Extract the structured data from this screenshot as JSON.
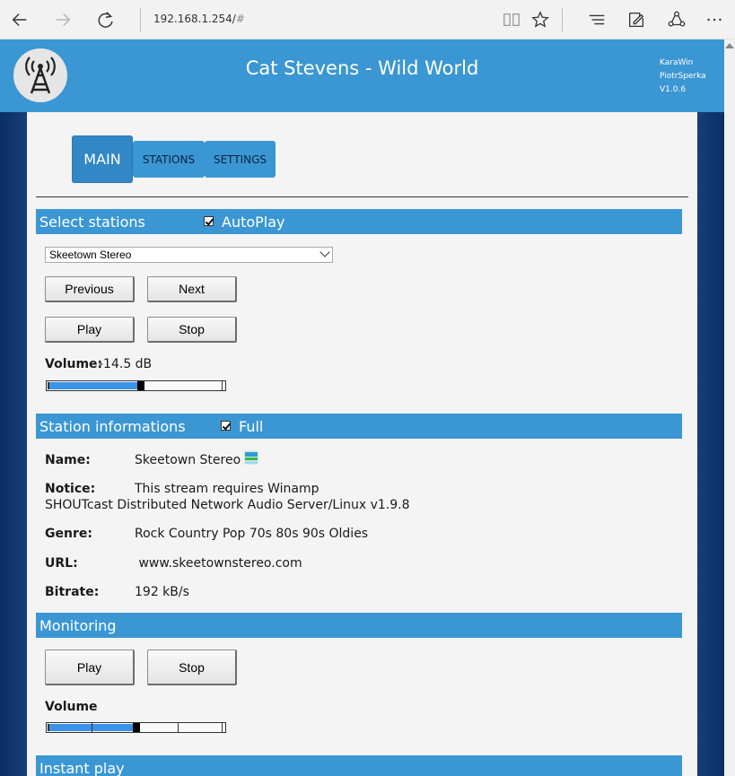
{
  "browser": {
    "url": "192.168.1.254/",
    "url_hash": "#"
  },
  "header": {
    "title": "Cat Stevens - Wild World",
    "credits": [
      "KaraWin",
      "PiotrSperka",
      "V1.0.6"
    ]
  },
  "tabs": [
    {
      "label": "MAIN",
      "active": true
    },
    {
      "label": "STATIONS",
      "active": false
    },
    {
      "label": "SETTINGS",
      "active": false
    }
  ],
  "select_stations": {
    "section_title": "Select stations",
    "autoplay_label": "AutoPlay",
    "autoplay_checked": true,
    "selected_station": "Skeetown Stereo",
    "previous_label": "Previous",
    "next_label": "Next",
    "play_label": "Play",
    "stop_label": "Stop",
    "volume_label": "Volume:",
    "volume_value": "-14.5 dB",
    "volume_level": 0.52
  },
  "station_info": {
    "section_title": "Station informations",
    "full_label": "Full",
    "full_checked": true,
    "name_label": "Name:",
    "name_value": "Skeetown Stereo",
    "notice_label": "Notice:",
    "notice_line1": "This stream requires Winamp",
    "notice_line2": "SHOUTcast Distributed Network Audio Server/Linux v1.9.8",
    "genre_label": "Genre:",
    "genre_value": "Rock Country Pop 70s 80s 90s Oldies",
    "url_label": "URL:",
    "url_value": " www.skeetownstereo.com",
    "bitrate_label": "Bitrate:",
    "bitrate_value": "192 kB/s"
  },
  "monitoring": {
    "section_title": "Monitoring",
    "play_label": "Play",
    "stop_label": "Stop",
    "volume_label": "Volume",
    "volume_level": 0.49
  },
  "instant_play": {
    "section_title": "Instant play"
  },
  "colors": {
    "accent": "#3b97d3",
    "slider_fill": "#3a93e8",
    "background_dark": "#0b2f63"
  }
}
